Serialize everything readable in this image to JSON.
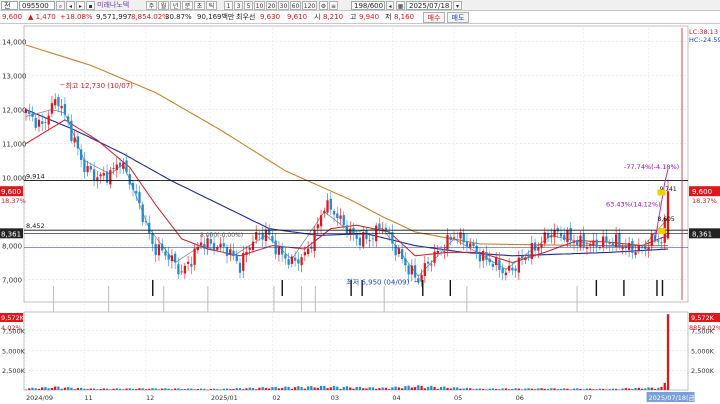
{
  "toolbar": {
    "market": "전",
    "code": "095500",
    "name": "미래나노텍",
    "periods": [
      "주",
      "월",
      "년",
      "분",
      "초",
      "틱"
    ],
    "minutes": [
      "1",
      "3",
      "5",
      "10",
      "20",
      "30",
      "60",
      "120"
    ],
    "page": "198/600",
    "date": "2025/07/18"
  },
  "quote": {
    "price": "9,600",
    "change": "▲ 1,470",
    "change_pct": "+18.08%",
    "volume": "9,571,997",
    "volume_pct": "8,854.02%",
    "turnover": "30.87%",
    "amount": "90,169백만",
    "pref_label": "최우선",
    "ask": "9,630",
    "bid": "9,610",
    "open_label": "시",
    "open": "8,210",
    "high_label": "고",
    "high": "9,940",
    "low_label": "저",
    "low": "8,160",
    "buy_label": "매수",
    "sell_label": "매도"
  },
  "colors": {
    "up": "#e0161b",
    "down": "#1f8ad6",
    "ma5": "#7a7a7a",
    "ma20": "#d01826",
    "ma60": "#1b2a9c",
    "ma120": "#c8822a",
    "volume_up": "#e0161b",
    "volume_down": "#1f8ad6"
  },
  "chart_data": {
    "type": "line",
    "subtype": "candlestick",
    "price_axis": {
      "ylim": [
        6400,
        14400
      ],
      "ticks": [
        "14,000",
        "13,000",
        "12,000",
        "11,000",
        "10,000",
        "8,000",
        "7,000"
      ]
    },
    "volume_axis": {
      "ylim": [
        0,
        9600000
      ],
      "ticks": [
        "7,500K",
        "5,000K",
        "2,500K"
      ]
    },
    "x_labels": [
      "2024/09",
      "11",
      "12",
      "2025/01",
      "02",
      "03",
      "04",
      "05",
      "06",
      "07",
      "2025/07/18(금)"
    ],
    "x_label_index": [
      0,
      18,
      37,
      57,
      76,
      94,
      113,
      132,
      151,
      172,
      192
    ],
    "n_bars": 199,
    "key_points": [
      {
        "x": 0,
        "close": 11900
      },
      {
        "x": 5,
        "close": 11500
      },
      {
        "x": 8,
        "close": 12100
      },
      {
        "x": 10,
        "close": 12300
      },
      {
        "x": 14,
        "close": 11300
      },
      {
        "x": 18,
        "close": 10300
      },
      {
        "x": 22,
        "close": 10000
      },
      {
        "x": 26,
        "close": 10100
      },
      {
        "x": 29,
        "close": 10500
      },
      {
        "x": 33,
        "close": 9700
      },
      {
        "x": 36,
        "close": 8900
      },
      {
        "x": 39,
        "close": 8000
      },
      {
        "x": 44,
        "close": 7700
      },
      {
        "x": 48,
        "close": 7200
      },
      {
        "x": 51,
        "close": 7600
      },
      {
        "x": 54,
        "close": 8100
      },
      {
        "x": 58,
        "close": 8000
      },
      {
        "x": 62,
        "close": 7900
      },
      {
        "x": 66,
        "close": 7400
      },
      {
        "x": 70,
        "close": 8200
      },
      {
        "x": 74,
        "close": 8400
      },
      {
        "x": 78,
        "close": 7800
      },
      {
        "x": 82,
        "close": 7500
      },
      {
        "x": 86,
        "close": 7700
      },
      {
        "x": 89,
        "close": 8300
      },
      {
        "x": 92,
        "close": 9200
      },
      {
        "x": 95,
        "close": 9000
      },
      {
        "x": 98,
        "close": 8600
      },
      {
        "x": 102,
        "close": 8200
      },
      {
        "x": 106,
        "close": 8200
      },
      {
        "x": 110,
        "close": 8600
      },
      {
        "x": 114,
        "close": 7900
      },
      {
        "x": 118,
        "close": 7300
      },
      {
        "x": 121,
        "close": 7000
      },
      {
        "x": 124,
        "close": 7500
      },
      {
        "x": 128,
        "close": 7900
      },
      {
        "x": 132,
        "close": 8300
      },
      {
        "x": 136,
        "close": 8100
      },
      {
        "x": 140,
        "close": 7700
      },
      {
        "x": 144,
        "close": 7500
      },
      {
        "x": 148,
        "close": 7200
      },
      {
        "x": 151,
        "close": 7400
      },
      {
        "x": 154,
        "close": 7700
      },
      {
        "x": 158,
        "close": 8000
      },
      {
        "x": 162,
        "close": 8400
      },
      {
        "x": 166,
        "close": 8300
      },
      {
        "x": 170,
        "close": 8100
      },
      {
        "x": 174,
        "close": 8000
      },
      {
        "x": 178,
        "close": 8100
      },
      {
        "x": 182,
        "close": 8100
      },
      {
        "x": 186,
        "close": 7900
      },
      {
        "x": 190,
        "close": 7900
      },
      {
        "x": 194,
        "close": 8200
      },
      {
        "x": 196,
        "close": 8130
      },
      {
        "x": 197,
        "close": 8600
      },
      {
        "x": 198,
        "close": 9600
      }
    ],
    "ma120": [
      {
        "x": 0,
        "y": 13900
      },
      {
        "x": 20,
        "y": 13300
      },
      {
        "x": 40,
        "y": 12500
      },
      {
        "x": 60,
        "y": 11400
      },
      {
        "x": 80,
        "y": 10200
      },
      {
        "x": 100,
        "y": 9350
      },
      {
        "x": 110,
        "y": 8850
      },
      {
        "x": 120,
        "y": 8400
      },
      {
        "x": 140,
        "y": 8050
      },
      {
        "x": 160,
        "y": 8020
      },
      {
        "x": 180,
        "y": 8000
      },
      {
        "x": 198,
        "y": 8000
      }
    ],
    "ma60": [
      {
        "x": 0,
        "y": 12000
      },
      {
        "x": 15,
        "y": 11400
      },
      {
        "x": 30,
        "y": 10700
      },
      {
        "x": 45,
        "y": 9900
      },
      {
        "x": 60,
        "y": 9200
      },
      {
        "x": 75,
        "y": 8500
      },
      {
        "x": 90,
        "y": 8300
      },
      {
        "x": 105,
        "y": 8350
      },
      {
        "x": 120,
        "y": 8000
      },
      {
        "x": 135,
        "y": 7800
      },
      {
        "x": 150,
        "y": 7700
      },
      {
        "x": 165,
        "y": 7750
      },
      {
        "x": 180,
        "y": 7800
      },
      {
        "x": 198,
        "y": 7900
      }
    ],
    "ma20": [
      {
        "x": 0,
        "y": 11000
      },
      {
        "x": 12,
        "y": 11700
      },
      {
        "x": 22,
        "y": 11100
      },
      {
        "x": 32,
        "y": 10300
      },
      {
        "x": 40,
        "y": 9200
      },
      {
        "x": 48,
        "y": 8200
      },
      {
        "x": 56,
        "y": 7900
      },
      {
        "x": 66,
        "y": 7700
      },
      {
        "x": 76,
        "y": 8000
      },
      {
        "x": 86,
        "y": 7900
      },
      {
        "x": 94,
        "y": 8500
      },
      {
        "x": 102,
        "y": 8600
      },
      {
        "x": 112,
        "y": 8400
      },
      {
        "x": 120,
        "y": 7700
      },
      {
        "x": 130,
        "y": 7800
      },
      {
        "x": 140,
        "y": 7800
      },
      {
        "x": 150,
        "y": 7500
      },
      {
        "x": 160,
        "y": 7800
      },
      {
        "x": 170,
        "y": 8150
      },
      {
        "x": 180,
        "y": 8100
      },
      {
        "x": 190,
        "y": 8000
      },
      {
        "x": 198,
        "y": 8300
      }
    ],
    "ma5": [
      {
        "x": 0,
        "y": 11800
      },
      {
        "x": 8,
        "y": 12000
      },
      {
        "x": 12,
        "y": 11900
      },
      {
        "x": 18,
        "y": 10500
      },
      {
        "x": 26,
        "y": 10100
      },
      {
        "x": 30,
        "y": 10400
      },
      {
        "x": 38,
        "y": 8500
      },
      {
        "x": 46,
        "y": 7500
      },
      {
        "x": 54,
        "y": 8000
      },
      {
        "x": 64,
        "y": 7700
      },
      {
        "x": 74,
        "y": 8300
      },
      {
        "x": 82,
        "y": 7600
      },
      {
        "x": 92,
        "y": 9000
      },
      {
        "x": 100,
        "y": 8400
      },
      {
        "x": 110,
        "y": 8500
      },
      {
        "x": 121,
        "y": 7100
      },
      {
        "x": 132,
        "y": 8200
      },
      {
        "x": 148,
        "y": 7300
      },
      {
        "x": 162,
        "y": 8300
      },
      {
        "x": 176,
        "y": 8000
      },
      {
        "x": 190,
        "y": 7950
      },
      {
        "x": 198,
        "y": 8800
      }
    ],
    "volume": [
      {
        "x": 0,
        "v": 150000
      },
      {
        "x": 10,
        "v": 300000
      },
      {
        "x": 20,
        "v": 120000
      },
      {
        "x": 40,
        "v": 150000
      },
      {
        "x": 60,
        "v": 100000
      },
      {
        "x": 75,
        "v": 250000
      },
      {
        "x": 92,
        "v": 350000
      },
      {
        "x": 110,
        "v": 200000
      },
      {
        "x": 120,
        "v": 400000
      },
      {
        "x": 140,
        "v": 120000
      },
      {
        "x": 160,
        "v": 150000
      },
      {
        "x": 180,
        "v": 100000
      },
      {
        "x": 196,
        "v": 250000
      },
      {
        "x": 197,
        "v": 900000
      },
      {
        "x": 198,
        "v": 9571997
      }
    ],
    "horizontal_lines": [
      {
        "value": 9914,
        "label": "9,914"
      },
      {
        "value": 8452,
        "label": "8,452"
      },
      {
        "value": 8361,
        "label": "8,361"
      }
    ],
    "annotations": {
      "high": {
        "x": 10,
        "value": 12730,
        "label": "최고 12,730 (10/07)"
      },
      "low": {
        "x": 121,
        "value": 6950,
        "label": "최저 6,950 (04/09)"
      },
      "pct1": "-77.74%(-4.18%)",
      "pct2": "63.43%(14.12%)",
      "last_close_label": "8,605",
      "mid_label": "9,741",
      "band_label": "8,000(-0.00%)"
    },
    "right_labels": {
      "lc": "LC:38.13",
      "hc": "HC:-24.59",
      "price": "9,600",
      "price_pct": "18.37%",
      "line_label": "8,361",
      "volume": "9,572K",
      "volume_pct": "8854.02%"
    },
    "left_labels": {
      "price": "9,600",
      "price_pct": "18.37%",
      "line_label": "8,361",
      "volume": "9,572K",
      "volume_pct": "4.02%"
    },
    "signal_marks_x": [
      46,
      93,
      118,
      122,
      144,
      154,
      207,
      217,
      229,
      231
    ]
  }
}
